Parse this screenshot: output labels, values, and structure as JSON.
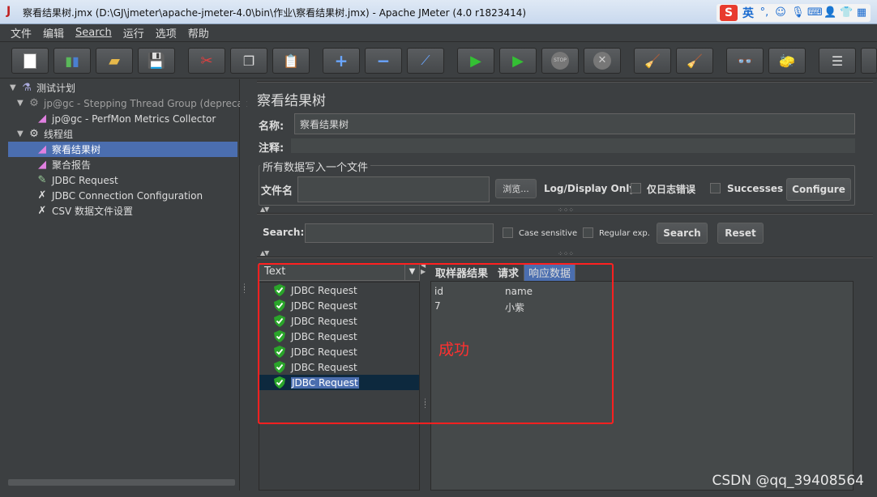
{
  "window": {
    "title": "察看结果树.jmx (D:\\GJ\\jmeter\\apache-jmeter-4.0\\bin\\作业\\察看结果树.jmx) - Apache JMeter (4.0 r1823414)",
    "app_icon": "J"
  },
  "ime": {
    "logo": "S",
    "lang": "英",
    "icons": [
      "punctuation-icon",
      "emoji-icon",
      "mic-icon",
      "keyboard-icon",
      "user-icon",
      "shirt-icon",
      "grid-icon"
    ]
  },
  "menu": [
    "文件",
    "编辑",
    "Search",
    "运行",
    "选项",
    "帮助"
  ],
  "toolbar": {
    "icons": [
      "new-icon",
      "templates-icon",
      "open-icon",
      "save-icon",
      "cut-icon",
      "copy-icon",
      "paste-icon",
      "expand-icon",
      "collapse-icon",
      "toggle-icon",
      "start-icon",
      "start-no-pause-icon",
      "stop-icon",
      "shutdown-icon",
      "clear-icon",
      "clear-all-icon",
      "search-icon",
      "reset-search-icon",
      "function-helper-icon",
      "help-icon"
    ]
  },
  "tree": [
    {
      "label": "测试计划",
      "level": 0,
      "toggle": "▼",
      "icon": "flask-icon"
    },
    {
      "label": "jp@gc - Stepping Thread Group (deprecate",
      "level": 1,
      "toggle": "▼",
      "icon": "gear-icon",
      "dim": true
    },
    {
      "label": "jp@gc - PerfMon Metrics Collector",
      "level": 2,
      "toggle": "",
      "icon": "chart-icon"
    },
    {
      "label": "线程组",
      "level": 1,
      "toggle": "▼",
      "icon": "gear-icon"
    },
    {
      "label": "察看结果树",
      "level": 2,
      "toggle": "",
      "icon": "chart-icon",
      "selected": true
    },
    {
      "label": "聚合报告",
      "level": 2,
      "toggle": "",
      "icon": "chart-icon"
    },
    {
      "label": "JDBC Request",
      "level": 2,
      "toggle": "",
      "icon": "pipette-icon"
    },
    {
      "label": "JDBC Connection Configuration",
      "level": 2,
      "toggle": "",
      "icon": "wrench-icon"
    },
    {
      "label": "CSV 数据文件设置",
      "level": 2,
      "toggle": "",
      "icon": "wrench-icon"
    }
  ],
  "panel": {
    "title": "察看结果树",
    "name_label": "名称:",
    "name_value": "察看结果树",
    "comment_label": "注释:",
    "file_group": "所有数据写入一个文件",
    "filename_label": "文件名",
    "browse_label": "浏览...",
    "log_only_label": "Log/Display Only:",
    "errors_label": "仅日志错误",
    "successes_label": "Successes",
    "configure_label": "Configure",
    "search_label": "Search:",
    "case_label": "Case sensitive",
    "regex_label": "Regular exp.",
    "search_button": "Search",
    "reset_button": "Reset",
    "renderer": "Text",
    "results": [
      "JDBC Request",
      "JDBC Request",
      "JDBC Request",
      "JDBC Request",
      "JDBC Request",
      "JDBC Request",
      "JDBC Request"
    ],
    "tabs": [
      "取样器结果",
      "请求",
      "响应数据"
    ],
    "response": {
      "headers": [
        "id",
        "name"
      ],
      "rows": [
        [
          "7",
          "小紫"
        ]
      ]
    }
  },
  "annotation": "成功",
  "watermark": "CSDN @qq_39408564"
}
